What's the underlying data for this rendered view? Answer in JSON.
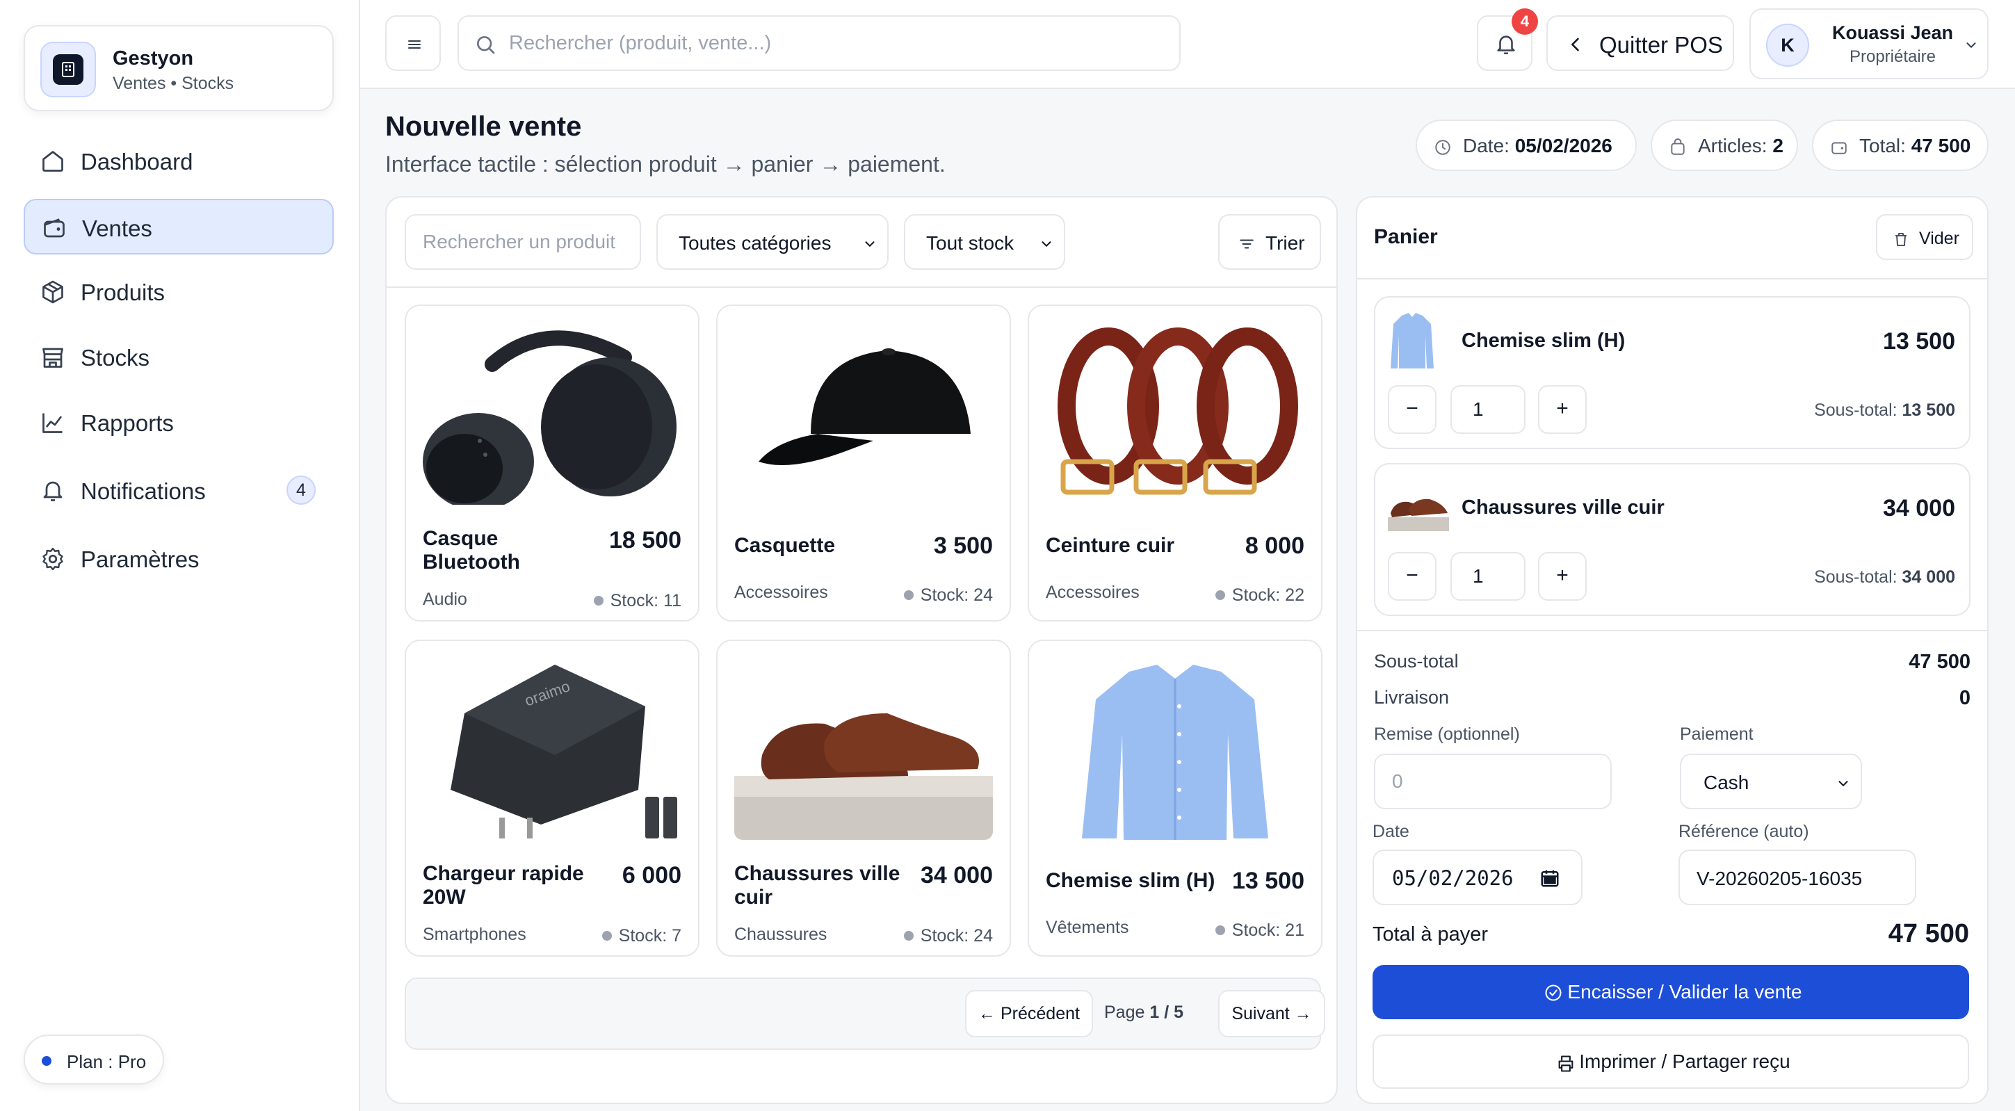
{
  "brand": {
    "name": "Gestyon",
    "subtitle": "Ventes • Stocks"
  },
  "sidebar": {
    "items": [
      {
        "label": "Dashboard",
        "icon": "home-icon"
      },
      {
        "label": "Ventes",
        "icon": "wallet-icon",
        "active": true
      },
      {
        "label": "Produits",
        "icon": "box-icon"
      },
      {
        "label": "Stocks",
        "icon": "store-icon"
      },
      {
        "label": "Rapports",
        "icon": "chart-line-icon"
      },
      {
        "label": "Notifications",
        "icon": "bell-icon",
        "badge": "4"
      },
      {
        "label": "Paramètres",
        "icon": "gear-icon"
      }
    ],
    "plan": "Plan : Pro"
  },
  "topbar": {
    "search_placeholder": "Rechercher (produit, vente...)",
    "notif_count": "4",
    "quit_label": "Quitter POS",
    "user": {
      "initial": "K",
      "name": "Kouassi Jean",
      "role": "Propriétaire"
    }
  },
  "header": {
    "title": "Nouvelle vente",
    "subtitle": "Interface tactile : sélection produit → panier → paiement.",
    "date_label": "Date:",
    "date_value": "05/02/2026",
    "articles_label": "Articles:",
    "articles_value": "2",
    "total_label": "Total:",
    "total_value": "47 500"
  },
  "filters": {
    "search_placeholder": "Rechercher un produit",
    "category": "Toutes catégories",
    "stock": "Tout stock",
    "sort_label": "Trier"
  },
  "products": [
    {
      "name": "Casque Bluetooth",
      "price": "18 500",
      "category": "Audio",
      "stock": "Stock: 11"
    },
    {
      "name": "Casquette",
      "price": "3 500",
      "category": "Accessoires",
      "stock": "Stock: 24"
    },
    {
      "name": "Ceinture cuir",
      "price": "8 000",
      "category": "Accessoires",
      "stock": "Stock: 22"
    },
    {
      "name": "Chargeur rapide 20W",
      "price": "6 000",
      "category": "Smartphones",
      "stock": "Stock: 7",
      "brand_mark": "oraimo"
    },
    {
      "name": "Chaussures ville cuir",
      "price": "34 000",
      "category": "Chaussures",
      "stock": "Stock: 24"
    },
    {
      "name": "Chemise slim (H)",
      "price": "13 500",
      "category": "Vêtements",
      "stock": "Stock: 21"
    }
  ],
  "pagination": {
    "prev_label": "← Précédent",
    "page_prefix": "Page",
    "page_current": "1 / 5",
    "next_label": "Suivant →"
  },
  "cart": {
    "title": "Panier",
    "clear_label": "Vider",
    "lines": [
      {
        "name": "Chemise slim (H)",
        "price": "13 500",
        "qty": "1",
        "subtotal_label": "Sous-total:",
        "subtotal": "13 500"
      },
      {
        "name": "Chaussures ville cuir",
        "price": "34 000",
        "qty": "1",
        "subtotal_label": "Sous-total:",
        "subtotal": "34 000"
      }
    ],
    "minus": "−",
    "plus": "+",
    "subtotal_label": "Sous-total",
    "subtotal_value": "47 500",
    "delivery_label": "Livraison",
    "delivery_value": "0",
    "discount_label": "Remise (optionnel)",
    "discount_placeholder": "0",
    "payment_label": "Paiement",
    "payment_value": "Cash",
    "date_label": "Date",
    "date_value": "05/02/2026",
    "ref_label": "Référence (auto)",
    "ref_value": "V-20260205-16035",
    "total_label": "Total à payer",
    "total_value": "47 500",
    "pay_button": "Encaisser / Valider la vente",
    "print_button": "Imprimer / Partager reçu"
  },
  "colors": {
    "accent": "#1d4ed8",
    "active_bg": "#e3ebff",
    "badge_red": "#ef4444"
  }
}
